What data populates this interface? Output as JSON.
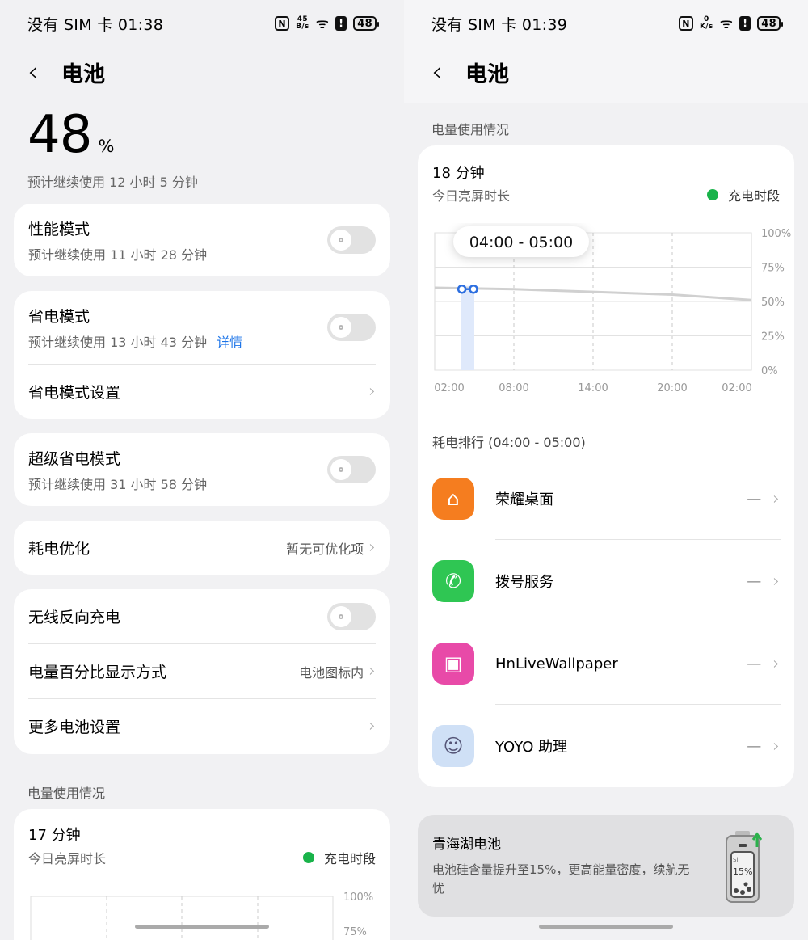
{
  "left": {
    "status": {
      "carrier": "没有 SIM 卡",
      "time": "01:38",
      "net_speed_top": "45",
      "net_speed_unit": "B/s",
      "battery": "48"
    },
    "header": {
      "title": "电池"
    },
    "battery_level": {
      "value": "48",
      "unit": "%"
    },
    "estimate": "预计继续使用 12 小时 5 分钟",
    "performance": {
      "label": "性能模式",
      "sub": "预计继续使用 11 小时 28 分钟"
    },
    "power_save": {
      "label": "省电模式",
      "sub": "预计继续使用 13 小时 43 分钟",
      "link": "详情",
      "settings_label": "省电模式设置"
    },
    "super_save": {
      "label": "超级省电模式",
      "sub": "预计继续使用 31 小时 58 分钟"
    },
    "optimize": {
      "label": "耗电优化",
      "value": "暂无可优化项"
    },
    "wireless": {
      "label": "无线反向充电"
    },
    "pct_display": {
      "label": "电量百分比显示方式",
      "value": "电池图标内"
    },
    "more": {
      "label": "更多电池设置"
    },
    "usage": {
      "section": "电量使用情况",
      "screen_time": "17 分钟",
      "screen_time_label": "今日亮屏时长",
      "legend": "充电时段",
      "ylabels": [
        "100%",
        "75%"
      ]
    }
  },
  "right": {
    "status": {
      "carrier": "没有 SIM 卡",
      "time": "01:39",
      "net_speed_top": "0",
      "net_speed_unit": "K/s",
      "battery": "48"
    },
    "header": {
      "title": "电池"
    },
    "usage": {
      "section": "电量使用情况",
      "screen_time": "18 分钟",
      "screen_time_label": "今日亮屏时长",
      "legend": "充电时段",
      "tooltip": "04:00 - 05:00"
    },
    "ranking": {
      "title": "耗电排行 (04:00 - 05:00)",
      "apps": [
        {
          "name": "荣耀桌面",
          "value": "—",
          "icon": "home-icon",
          "color": "#f57d1f"
        },
        {
          "name": "拨号服务",
          "value": "—",
          "icon": "phone-icon",
          "color": "#2fc653"
        },
        {
          "name": "HnLiveWallpaper",
          "value": "—",
          "icon": "wallpaper-icon",
          "color": "#e84aa8"
        },
        {
          "name": "YOYO 助理",
          "value": "—",
          "icon": "assistant-icon",
          "color": "#cfe0f6"
        }
      ]
    },
    "promo": {
      "title": "青海湖电池",
      "desc": "电池硅含量提升至15%，更高能量密度，续航无忧",
      "badge": "15%",
      "badge_si": "Si"
    }
  },
  "chart_data": {
    "type": "line",
    "title": "",
    "x": [
      "02:00",
      "08:00",
      "14:00",
      "20:00",
      "02:00"
    ],
    "xlabel": "",
    "ylabel": "",
    "ylim": [
      0,
      100
    ],
    "yticks": [
      "0%",
      "25%",
      "50%",
      "75%",
      "100%"
    ],
    "series": [
      {
        "values": [
          60,
          59,
          57,
          55,
          51
        ]
      }
    ],
    "highlight": {
      "label": "04:00 - 05:00",
      "value": 59
    },
    "grid": true
  }
}
